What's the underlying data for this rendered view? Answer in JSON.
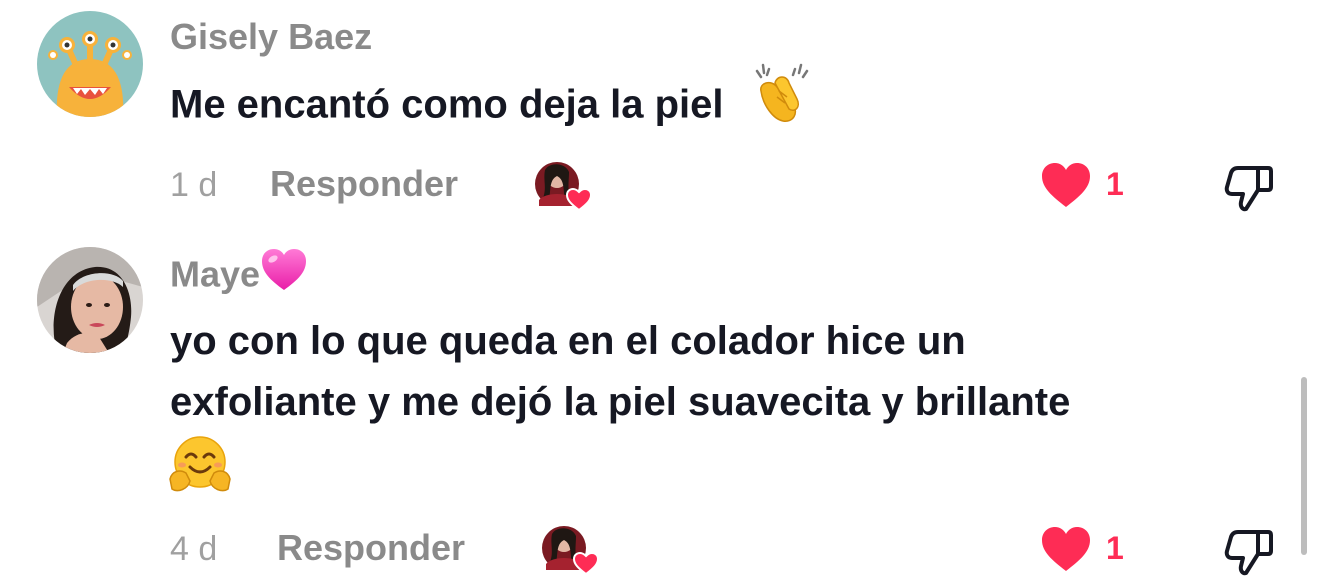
{
  "comments": [
    {
      "username": "Gisely Baez",
      "text": "Me encantó como deja la piel",
      "time": "1 d",
      "reply_label": "Responder",
      "likes": "1",
      "liked": true
    },
    {
      "username": "Maye",
      "text_line1": "yo con lo que queda en el colador hice un",
      "text_line2": "exfoliante y me dejó la piel suavecita y brillante",
      "time": "4 d",
      "reply_label": "Responder",
      "likes": "1",
      "liked": true
    }
  ],
  "icons": {
    "clap": "clapping-hands-emoji",
    "heart_name": "pink-heart-emoji",
    "hug": "hugging-face-emoji",
    "like": "heart-icon",
    "dislike": "thumbs-down-icon",
    "creator_like": "creator-liked-badge"
  },
  "colors": {
    "like": "#fe2c55",
    "username": "#8a8a8a",
    "text": "#161823",
    "time": "#a0a0a0"
  }
}
